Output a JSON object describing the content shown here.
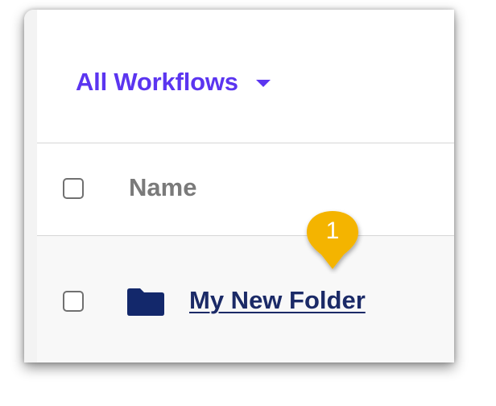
{
  "toolbar": {
    "workflows_dropdown_label": "All Workflows",
    "dropdown_icon": "caret-down-icon"
  },
  "table": {
    "columns": [
      {
        "label": "Name"
      }
    ],
    "rows": [
      {
        "name": "My New Folder",
        "type": "folder",
        "icon": "folder-icon",
        "checked": false
      }
    ]
  },
  "callout": {
    "number": "1",
    "color": "#f4b400"
  },
  "colors": {
    "accent": "#5b35f0",
    "link": "#1b2a67",
    "header_text": "#7a7a7a",
    "folder": "#13286b"
  }
}
